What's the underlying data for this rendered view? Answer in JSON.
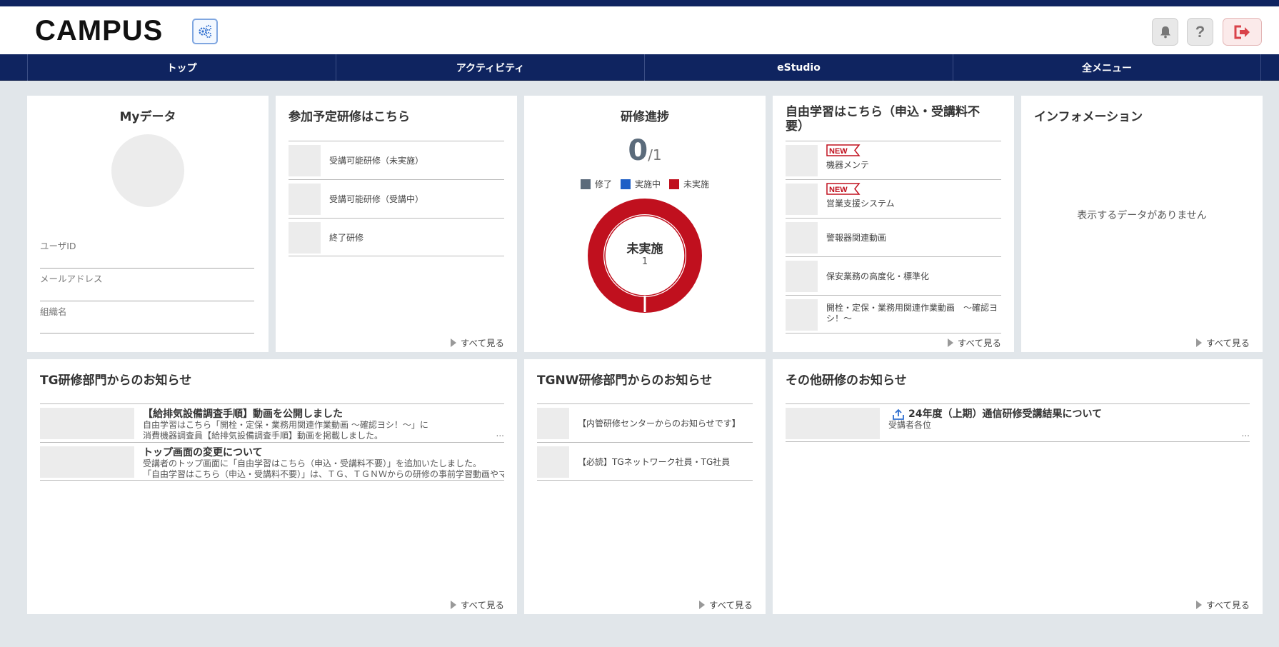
{
  "app": {
    "logo": "CAMPUS",
    "help_label": "?"
  },
  "nav": {
    "items": [
      "トップ",
      "アクティビティ",
      "eStudio",
      "全メニュー"
    ]
  },
  "mydata": {
    "title": "Myデータ",
    "fields": [
      "ユーザID",
      "メールアドレス",
      "組織名"
    ]
  },
  "scheduled": {
    "title": "参加予定研修はこちら",
    "items": [
      "受講可能研修（未実施）",
      "受講可能研修（受講中）",
      "終了研修"
    ],
    "see_all": "すべて見る"
  },
  "progress": {
    "title": "研修進捗",
    "count": "0",
    "total": "/1",
    "legend": [
      {
        "label": "修了",
        "color": "#5b6b7b"
      },
      {
        "label": "実施中",
        "color": "#1f5fc6"
      },
      {
        "label": "未実施",
        "color": "#c0101e"
      }
    ],
    "center_label": "未実施",
    "center_value": "1",
    "completed": 0,
    "in_progress": 0,
    "not_started": 1
  },
  "free_study": {
    "title_line1": "自由学習はこちら（申込・受講料不",
    "title_line2": "要）",
    "new_badge": "NEW",
    "items": [
      {
        "label": "機器メンテ",
        "is_new": true
      },
      {
        "label": "営業支援システム",
        "is_new": true
      },
      {
        "label": "警報器関連動画",
        "is_new": false
      },
      {
        "label": "保安業務の高度化・標準化",
        "is_new": false
      },
      {
        "label_line1": "開栓・定保・業務用関連作業動画　～確認ヨ",
        "label_line2": "シ！～",
        "is_new": false
      }
    ],
    "see_all": "すべて見る"
  },
  "information": {
    "title": "インフォメーション",
    "empty": "表示するデータがありません",
    "see_all": "すべて見る"
  },
  "tg_notice": {
    "title": "TG研修部門からのお知らせ",
    "items": [
      {
        "title": "【給排気設備調査手順】動画を公開しました",
        "line1": "自由学習はこちら「開栓・定保・業務用関連作業動画 ～確認ヨシ！～」に",
        "line2": "消費機器調査員【給排気設備調査手順】動画を掲載しました。",
        "more": "..."
      },
      {
        "title": "トップ画面の変更について",
        "line1": "受講者のトップ画面に「自由学習はこちら（申込・受講料不要）」を追加いたしました。",
        "line2": "「自由学習はこちら（申込・受講料不要）」は、ＴＧ、ＴＧＮＷからの研修の事前学習動画やマ…",
        "more": ""
      }
    ],
    "see_all": "すべて見る"
  },
  "tgnw_notice": {
    "title": "TGNW研修部門からのお知らせ",
    "items": [
      "【内管研修センターからのお知らせです】",
      "【必読】TGネットワーク社員・TG社員"
    ],
    "see_all": "すべて見る"
  },
  "other_notice": {
    "title": "その他研修のお知らせ",
    "items": [
      {
        "title": "24年度（上期）通信研修受講結果について",
        "body": "受講者各位",
        "more": "..."
      }
    ],
    "see_all": "すべて見る"
  }
}
